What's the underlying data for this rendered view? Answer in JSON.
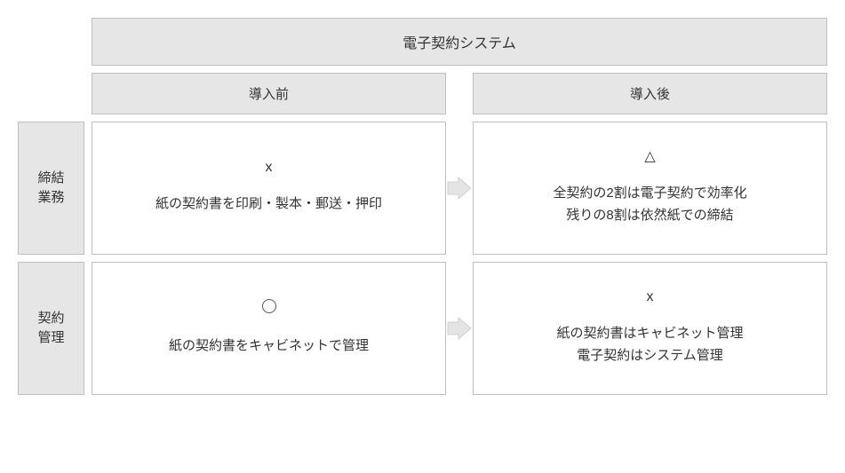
{
  "title": "電子契約システム",
  "columns": {
    "before": "導入前",
    "after": "導入後"
  },
  "rows": [
    {
      "label": "締結\n業務",
      "before": {
        "symbol": "x",
        "text": "紙の契約書を印刷・製本・郵送・押印"
      },
      "after": {
        "symbol": "△",
        "text": "全契約の2割は電子契約で効率化\n残りの8割は依然紙での締結"
      }
    },
    {
      "label": "契約\n管理",
      "before": {
        "symbol": "○",
        "text": "紙の契約書をキャビネットで管理"
      },
      "after": {
        "symbol": "x",
        "text": "紙の契約書はキャビネット管理\n電子契約はシステム管理"
      }
    }
  ]
}
